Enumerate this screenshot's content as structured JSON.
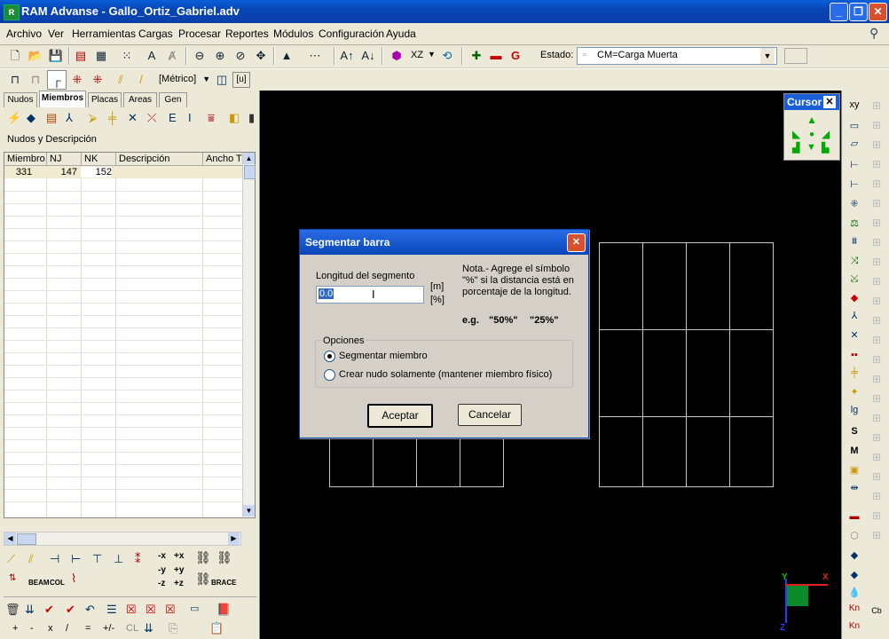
{
  "window": {
    "title": "RAM Advanse - Gallo_Ortiz_Gabriel.adv"
  },
  "menu": [
    "Archivo",
    "Ver",
    "Herramientas",
    "Cargas",
    "Procesar",
    "Reportes",
    "Módulos",
    "Configuración",
    "Ayuda"
  ],
  "toolbar": {
    "estado_label": "Estado:",
    "estado_value": "CM=Carga Muerta",
    "units_value": "[Métrico]",
    "plane_value": "XZ",
    "u_label": "[u]"
  },
  "left_panel": {
    "tabs": [
      "Nudos",
      "Miembros",
      "Placas",
      "Areas",
      "Gen"
    ],
    "section_title": "Nudos y Descripción",
    "columns": [
      "Miembro",
      "NJ",
      "NK",
      "Descripción",
      "Ancho T"
    ],
    "rows": [
      {
        "miembro": "331",
        "nj": "147",
        "nk": "152",
        "descripcion": ""
      }
    ],
    "buttons_row1": [
      "-x",
      "+x"
    ],
    "buttons_row2": [
      "-y",
      "+y"
    ],
    "buttons_row3": [
      "-z",
      "+z"
    ],
    "beam_label": "BEAM",
    "col_label": "COL",
    "brace_label": "BRACE",
    "calc_keys": [
      "+",
      "-",
      "x",
      "/",
      "=",
      "+/-",
      "CL"
    ]
  },
  "cursor_panel": {
    "title": "Cursor"
  },
  "right_bar": {
    "labels": [
      "xy",
      "S",
      "M",
      "Kn",
      "Kn",
      "Cb"
    ]
  },
  "dialog": {
    "title": "Segmentar barra",
    "length_label": "Longitud del segmento",
    "length_value": "0.0",
    "unit_m": "[m]",
    "unit_pct": "[%]",
    "note": "Nota.- Agrege el símbolo \"%\" si la distancia está en porcentaje de la longitud.",
    "example_prefix": "e.g.",
    "example_1": "\"50%\"",
    "example_2": "\"25%\"",
    "options_label": "Opciones",
    "option_1": "Segmentar miembro",
    "option_2": "Crear nudo solamente (mantener miembro físico)",
    "ok": "Aceptar",
    "cancel": "Cancelar"
  },
  "axes": {
    "x": "X",
    "y": "Y",
    "z": "Z"
  }
}
